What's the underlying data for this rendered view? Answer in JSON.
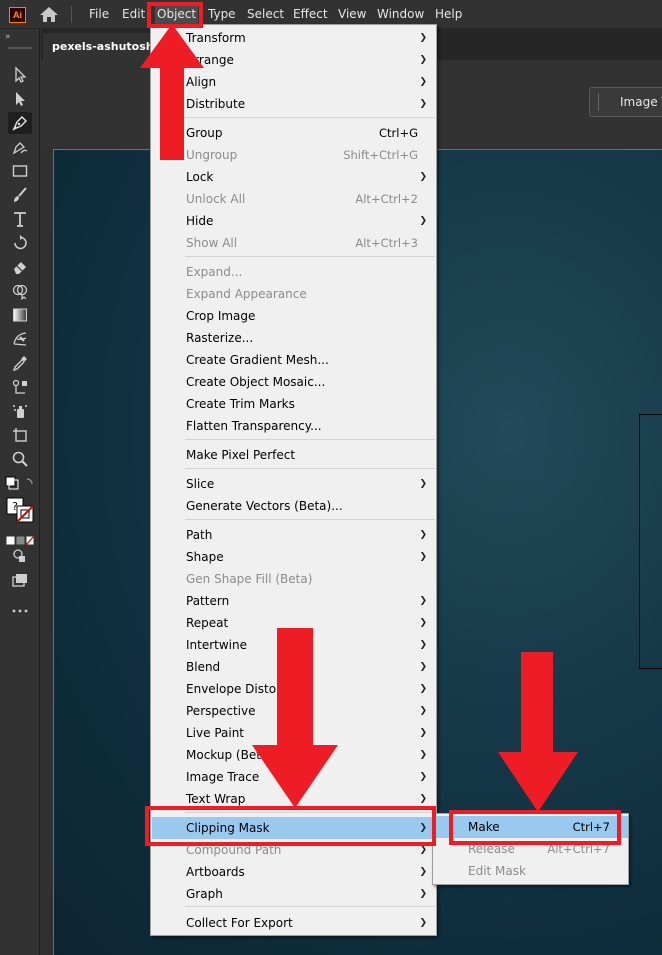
{
  "app": {
    "logo_text": "Ai"
  },
  "menubar": {
    "items": [
      "File",
      "Edit",
      "Object",
      "Type",
      "Select",
      "Effect",
      "View",
      "Window",
      "Help"
    ],
    "active": "Object"
  },
  "document": {
    "tab_title": "pexels-ashutoshsonwani"
  },
  "control_bar": {
    "image_trace_label": "Image Trace"
  },
  "object_menu": {
    "items": [
      {
        "label": "Transform",
        "submenu": true
      },
      {
        "label": "Arrange",
        "submenu": true
      },
      {
        "label": "Align",
        "submenu": true
      },
      {
        "label": "Distribute",
        "submenu": true
      },
      {
        "label": "Group",
        "shortcut": "Ctrl+G"
      },
      {
        "label": "Ungroup",
        "shortcut": "Shift+Ctrl+G",
        "disabled": true
      },
      {
        "label": "Lock",
        "submenu": true
      },
      {
        "label": "Unlock All",
        "shortcut": "Alt+Ctrl+2",
        "disabled": true
      },
      {
        "label": "Hide",
        "submenu": true
      },
      {
        "label": "Show All",
        "shortcut": "Alt+Ctrl+3",
        "disabled": true
      },
      {
        "label": "Expand...",
        "disabled": true
      },
      {
        "label": "Expand Appearance",
        "disabled": true
      },
      {
        "label": "Crop Image"
      },
      {
        "label": "Rasterize..."
      },
      {
        "label": "Create Gradient Mesh..."
      },
      {
        "label": "Create Object Mosaic..."
      },
      {
        "label": "Create Trim Marks"
      },
      {
        "label": "Flatten Transparency..."
      },
      {
        "label": "Make Pixel Perfect"
      },
      {
        "label": "Slice",
        "submenu": true
      },
      {
        "label": "Generate Vectors (Beta)..."
      },
      {
        "label": "Path",
        "submenu": true
      },
      {
        "label": "Shape",
        "submenu": true
      },
      {
        "label": "Gen Shape Fill (Beta)",
        "disabled": true
      },
      {
        "label": "Pattern",
        "submenu": true
      },
      {
        "label": "Repeat",
        "submenu": true
      },
      {
        "label": "Intertwine",
        "submenu": true
      },
      {
        "label": "Blend",
        "submenu": true
      },
      {
        "label": "Envelope Distort",
        "submenu": true
      },
      {
        "label": "Perspective",
        "submenu": true
      },
      {
        "label": "Live Paint",
        "submenu": true
      },
      {
        "label": "Mockup (Beta)",
        "submenu": true
      },
      {
        "label": "Image Trace",
        "submenu": true
      },
      {
        "label": "Text Wrap",
        "submenu": true
      },
      {
        "label": "Clipping Mask",
        "submenu": true,
        "highlighted": true
      },
      {
        "label": "Compound Path",
        "submenu": true,
        "disabled": true
      },
      {
        "label": "Artboards",
        "submenu": true
      },
      {
        "label": "Graph",
        "submenu": true
      },
      {
        "label": "Collect For Export",
        "submenu": true
      }
    ]
  },
  "clipping_mask_submenu": {
    "items": [
      {
        "label": "Make",
        "shortcut": "Ctrl+7",
        "highlighted": true
      },
      {
        "label": "Release",
        "shortcut": "Alt+Ctrl+7",
        "disabled": true
      },
      {
        "label": "Edit Mask",
        "disabled": true
      }
    ]
  },
  "icons": {
    "toolbar": [
      "collapse-icon",
      "selection-tool-icon",
      "direct-selection-tool-icon",
      "pen-tool-icon",
      "curvature-tool-icon",
      "rectangle-tool-icon",
      "paintbrush-tool-icon",
      "type-tool-icon",
      "rotate-tool-icon",
      "eraser-tool-icon",
      "shape-builder-tool-icon",
      "gradient-tool-icon",
      "mesh-tool-icon",
      "eyedropper-tool-icon",
      "blend-tool-icon",
      "symbol-sprayer-tool-icon",
      "artboard-tool-icon",
      "zoom-tool-icon",
      "fill-stroke-icon",
      "draw-mode-icon",
      "change-screen-mode-icon",
      "edit-toolbar-icon"
    ]
  },
  "colors": {
    "annotation_red": "#ee1c24",
    "menu_highlight": "#99c9ef",
    "selection_blue": "#3a78d6"
  }
}
